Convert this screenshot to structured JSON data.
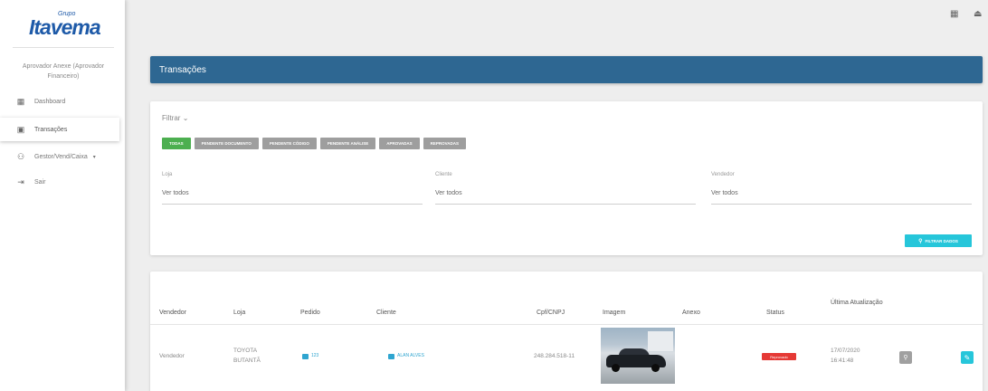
{
  "brand": {
    "group": "Grupo",
    "name": "Itavema"
  },
  "sidebar": {
    "user_label": "Aprovador Anexe (Aprovador Financeiro)",
    "items": [
      {
        "label": "Dashboard",
        "icon": "dashboard-icon"
      },
      {
        "label": "Transações",
        "icon": "transactions-icon"
      },
      {
        "label": "Gestor/Vend/Caixa",
        "icon": "users-icon"
      },
      {
        "label": "Sair",
        "icon": "logout-icon"
      }
    ]
  },
  "top_icons": [
    "grid-icon",
    "user-icon"
  ],
  "page_title": "Transações",
  "filter": {
    "toggle_label": "Filtrar",
    "chips": [
      "Todas",
      "Pendente documento",
      "Pendente código",
      "Pendente análise",
      "Aprovadas",
      "Reprovadas"
    ],
    "active_chip": "Todas",
    "fields": [
      {
        "label": "Loja",
        "value": "Ver todos"
      },
      {
        "label": "Cliente",
        "value": "Ver todos"
      },
      {
        "label": "Vendedor",
        "value": "Ver todos"
      }
    ],
    "button_label": "Filtrar dados"
  },
  "table": {
    "headers": [
      "Vendedor",
      "Loja",
      "Pedido",
      "Cliente",
      "Cpf/CNPJ",
      "Imagem",
      "Anexo",
      "Status",
      "Última Atualização"
    ],
    "rows": [
      {
        "vendedor": "Vendedor",
        "loja": "TOYOTA BUTANTÃ",
        "pedido": "123",
        "cliente": "Alan Alves",
        "cpf": "248.284.518-11",
        "imagem": "car-photo",
        "anexo": "",
        "status": "Reprovado",
        "ultima_atualizacao": "17/07/2020 16:41:48"
      }
    ]
  },
  "colors": {
    "title_bar": "#2e6792",
    "active_chip": "#4caf50",
    "chip": "#9e9e9e",
    "accent": "#26c6da",
    "status_rejected": "#e53935",
    "link": "#2fa5d0"
  }
}
